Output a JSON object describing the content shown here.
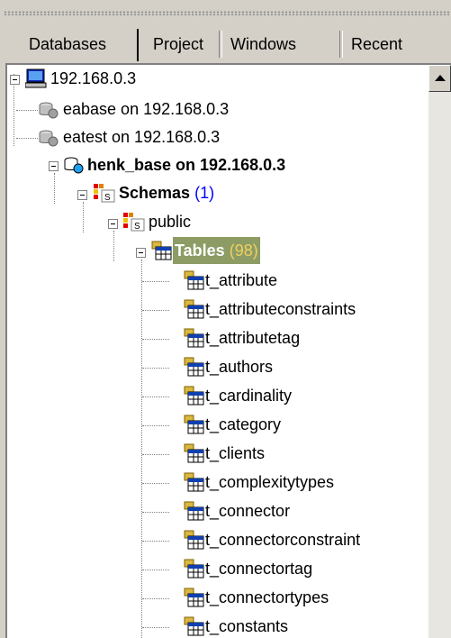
{
  "tabs": [
    "Databases",
    "Project",
    "Windows",
    "Recent"
  ],
  "tree": {
    "server": "192.168.0.3",
    "databases": [
      "eabase on 192.168.0.3",
      "eatest on 192.168.0.3",
      "henk_base on 192.168.0.3"
    ],
    "schemas_label": "Schemas",
    "schemas_count": "(1)",
    "schema": "public",
    "tables_label": "Tables",
    "tables_count": "(98)",
    "tables": [
      "t_attribute",
      "t_attributeconstraints",
      "t_attributetag",
      "t_authors",
      "t_cardinality",
      "t_category",
      "t_clients",
      "t_complexitytypes",
      "t_connector",
      "t_connectorconstraint",
      "t_connectortag",
      "t_connectortypes",
      "t_constants"
    ]
  },
  "colors": {
    "selection": "#8c9c64",
    "count": "#0000ff",
    "selected_count": "#f0d060"
  },
  "icons": [
    "computer-icon",
    "database-icon",
    "schema-icon",
    "table-icon",
    "scroll-up-arrow-icon"
  ]
}
